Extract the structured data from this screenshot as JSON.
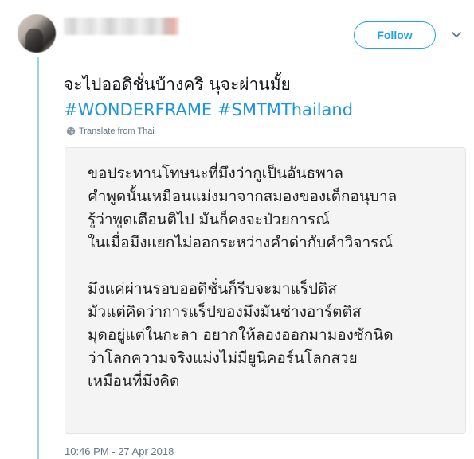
{
  "header": {
    "follow_label": "Follow"
  },
  "tweet": {
    "text": "จะไปออดิชั่นบ้างคริ นุจะผ่านมั้ย",
    "hashtags": [
      "#WONDERFRAME",
      "#SMTMThailand"
    ],
    "translate_label": "Translate from Thai",
    "timestamp": "10:46 PM - 27 Apr 2018"
  },
  "image_text": {
    "stanza1": [
      "ขอประทานโทษนะที่มึงว่ากูเป็นอันธพาล",
      "คำพูดนั้นเหมือนแม่งมาจากสมองของเด็กอนุบาล",
      "รู้ว่าพูดเตือนติไป มันก็คงจะป่วยการณ์",
      "ในเมื่อมึงแยกไม่ออกระหว่างคำด่ากับคำวิจารณ์"
    ],
    "stanza2": [
      "มึงแค่ผ่านรอบออดิชั่นก็รีบจะมาแร็ปดิส",
      "มัวแต่คิดว่าการแร็ปของมึงมันช่างอาร์ตติส",
      "มุดอยู่แต่ในกะลา อยากให้ลองออกมามองซักนิด",
      "ว่าโลกความจริงแม่งไม่มียูนิคอร์นโลกสวย",
      "เหมือนที่มึงคิด"
    ]
  },
  "colors": {
    "accent": "#1da1f2",
    "hashtag": "#1b95e0",
    "thread_line": "#9fd3ea",
    "muted": "#657786"
  },
  "icons": [
    "chevron-down-icon",
    "globe-icon"
  ]
}
